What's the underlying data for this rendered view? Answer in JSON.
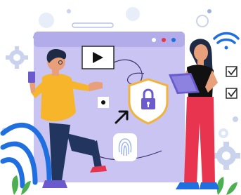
{
  "illustration": {
    "icons": [
      "play-icon",
      "shield-lock-icon",
      "wifi-icon",
      "fingerprint-icon",
      "checkbox-icon",
      "gear-icon",
      "cursor-icon",
      "dots-icon"
    ],
    "colors": {
      "screen": "#c9c4f2",
      "screen_header": "#b3acea",
      "shield": "#f2b33a",
      "lock": "#6a5acd",
      "wifi": "#1f6fe0",
      "shirt_man": "#f7b52b",
      "pants_man": "#22355e",
      "woman_top": "#111111",
      "woman_pants": "#e8344e",
      "tablet": "#6a5acd",
      "background_blob": "#e8eef9",
      "leaf": "#4caf50"
    }
  }
}
